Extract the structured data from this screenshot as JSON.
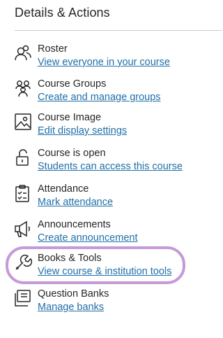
{
  "panel": {
    "title": "Details & Actions"
  },
  "items": [
    {
      "label": "Roster",
      "link": "View everyone in your course",
      "icon": "people-icon"
    },
    {
      "label": "Course Groups",
      "link": "Create and manage groups",
      "icon": "groups-icon"
    },
    {
      "label": "Course Image",
      "link": "Edit display settings",
      "icon": "image-icon"
    },
    {
      "label": "Course is open",
      "link": "Students can access this course",
      "icon": "unlock-icon"
    },
    {
      "label": "Attendance",
      "link": "Mark attendance",
      "icon": "clipboard-icon"
    },
    {
      "label": "Announcements",
      "link": "Create announcement",
      "icon": "megaphone-icon"
    },
    {
      "label": "Books & Tools",
      "link": "View course & institution tools",
      "icon": "wrench-icon"
    },
    {
      "label": "Question Banks",
      "link": "Manage banks",
      "icon": "question-bank-icon"
    }
  ],
  "colors": {
    "link": "#1f6fa8",
    "highlight": "#c59ad9",
    "text": "#262626"
  }
}
